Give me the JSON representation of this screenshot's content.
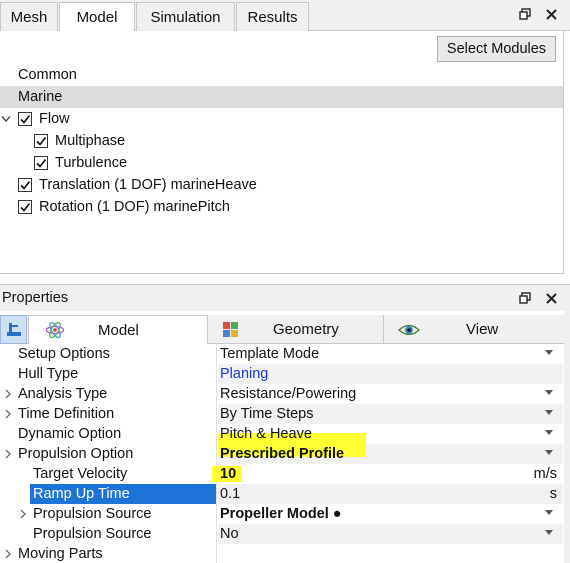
{
  "top_tabs": [
    {
      "label": "Mesh",
      "active": false
    },
    {
      "label": "Model",
      "active": true
    },
    {
      "label": "Simulation",
      "active": false
    },
    {
      "label": "Results",
      "active": false
    }
  ],
  "window_controls": {
    "dock_icon": "dock-icon",
    "close_icon": "close-icon"
  },
  "model_panel": {
    "select_modules_label": "Select Modules",
    "tree": [
      {
        "label": "Common",
        "checkbox": false,
        "checked": false,
        "level": 0
      },
      {
        "label": "Marine",
        "checkbox": false,
        "checked": false,
        "level": 0,
        "selected": true
      },
      {
        "label": "Flow",
        "checkbox": true,
        "checked": true,
        "level": 0,
        "expanded": true
      },
      {
        "label": "Multiphase",
        "checkbox": true,
        "checked": true,
        "level": 1
      },
      {
        "label": "Turbulence",
        "checkbox": true,
        "checked": true,
        "level": 1
      },
      {
        "label": "Translation (1 DOF) marineHeave",
        "checkbox": true,
        "checked": true,
        "level": 0
      },
      {
        "label": "Rotation (1 DOF) marinePitch",
        "checkbox": true,
        "checked": true,
        "level": 0
      }
    ]
  },
  "properties": {
    "header": "Properties",
    "tabs": [
      {
        "label": "Model",
        "icon": "atom-icon",
        "active": true
      },
      {
        "label": "Geometry",
        "icon": "cubes-icon",
        "active": false
      },
      {
        "label": "View",
        "icon": "eye-icon",
        "active": false
      }
    ],
    "rows": [
      {
        "name": "Setup Options",
        "value": "Template Mode",
        "dropdown": true
      },
      {
        "name": "Hull Type",
        "value": "Planing",
        "link": true
      },
      {
        "name": "Analysis Type",
        "value": "Resistance/Powering",
        "dropdown": true,
        "expandable": true
      },
      {
        "name": "Time Definition",
        "value": "By Time Steps",
        "dropdown": true,
        "expandable": true
      },
      {
        "name": "Dynamic Option",
        "value": "Pitch & Heave",
        "dropdown": true
      },
      {
        "name": "Propulsion Option",
        "value": "Prescribed Profile",
        "dropdown": true,
        "expandable": true,
        "bold": true
      },
      {
        "name": "Target Velocity",
        "value": "10",
        "unit": "m/s",
        "bold": true,
        "indent": true
      },
      {
        "name": "Ramp Up Time",
        "value": "0.1",
        "unit": "s",
        "indent": true,
        "selected": true
      },
      {
        "name": "Propulsion Source",
        "value": "Propeller Model ●",
        "dropdown": true,
        "expandable": true,
        "bold": true,
        "indent": true
      },
      {
        "name": "Propulsion Source",
        "value": "No",
        "dropdown": true,
        "indent": true
      },
      {
        "name": "Moving Parts",
        "value": "",
        "expandable": true
      }
    ]
  },
  "colors": {
    "link_blue": "#1a3ccc",
    "selected_blue": "#1e74d6",
    "highlight_yellow": "#ffff33"
  }
}
